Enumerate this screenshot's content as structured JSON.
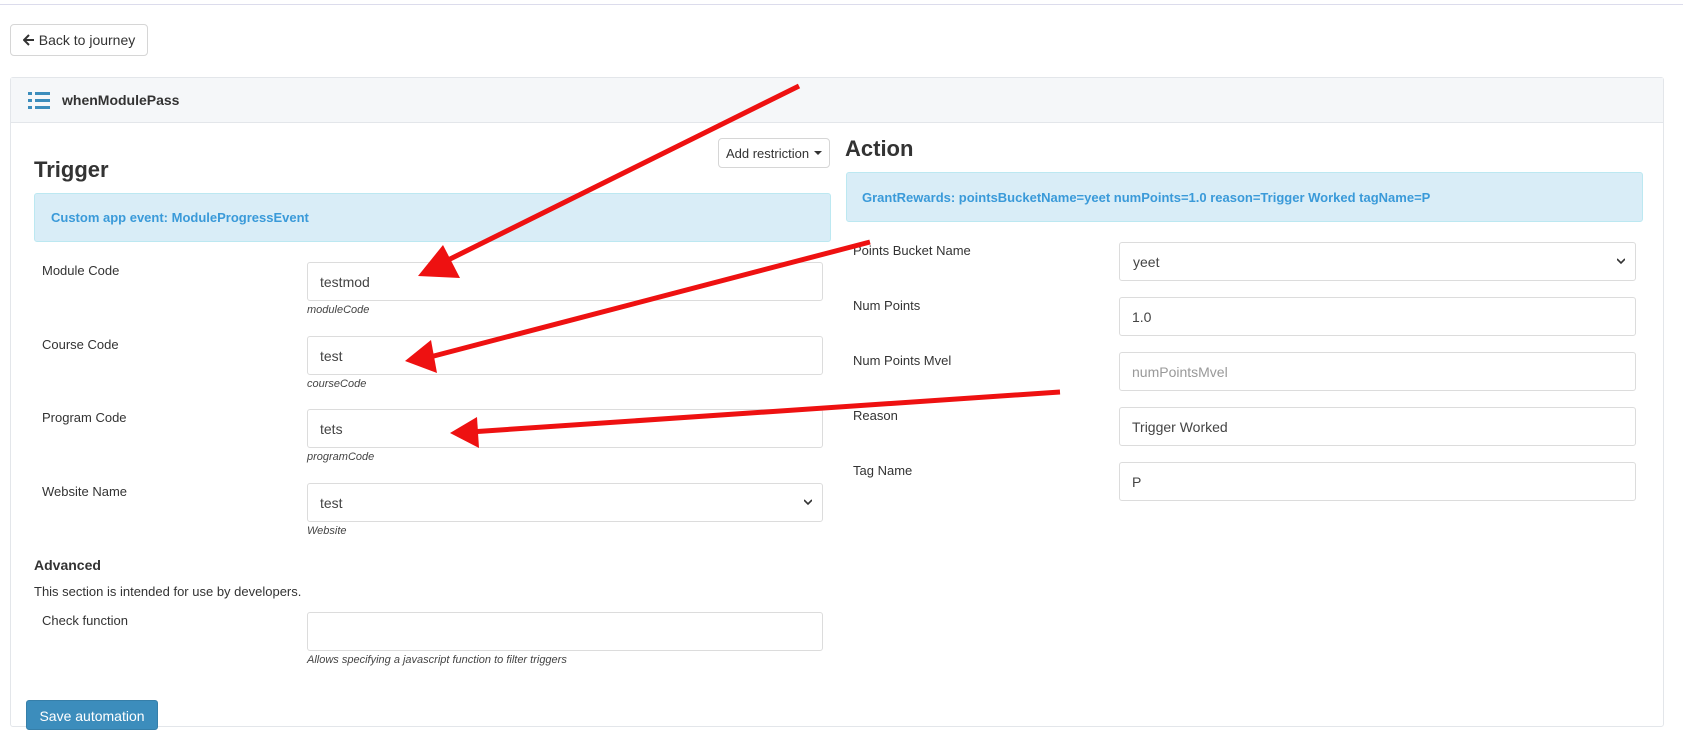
{
  "nav": {
    "back_label": "Back to journey"
  },
  "panel": {
    "title": "whenModulePass"
  },
  "trigger": {
    "heading": "Trigger",
    "add_restriction_label": "Add restriction",
    "event_text": "Custom app event: ModuleProgressEvent",
    "fields": [
      {
        "label": "Module Code",
        "value": "testmod",
        "help": "moduleCode"
      },
      {
        "label": "Course Code",
        "value": "test",
        "help": "courseCode"
      },
      {
        "label": "Program Code",
        "value": "tets",
        "help": "programCode"
      },
      {
        "label": "Website Name",
        "value": "test",
        "help": "Website"
      }
    ]
  },
  "advanced": {
    "title": "Advanced",
    "description": "This section is intended for use by developers.",
    "check_label": "Check function",
    "check_value": "",
    "check_help": "Allows specifying a javascript function to filter triggers"
  },
  "action": {
    "heading": "Action",
    "summary": "GrantRewards: pointsBucketName=yeet numPoints=1.0 reason=Trigger Worked tagName=P",
    "fields": [
      {
        "label": "Points Bucket Name",
        "value": "yeet"
      },
      {
        "label": "Num Points",
        "value": "1.0"
      },
      {
        "label": "Num Points Mvel",
        "placeholder": "numPointsMvel"
      },
      {
        "label": "Reason",
        "value": "Trigger Worked"
      },
      {
        "label": "Tag Name",
        "value": "P"
      }
    ]
  },
  "footer": {
    "save_label": "Save automation"
  },
  "colors": {
    "accent": "#3c8dbc",
    "alert_bg": "#d9edf7",
    "alert_text": "#3a9ad9",
    "annotation_arrow": "#ee1111"
  },
  "icons": {
    "back": "arrow-left-icon",
    "list": "list-icon",
    "dropdown": "caret-down-icon"
  }
}
